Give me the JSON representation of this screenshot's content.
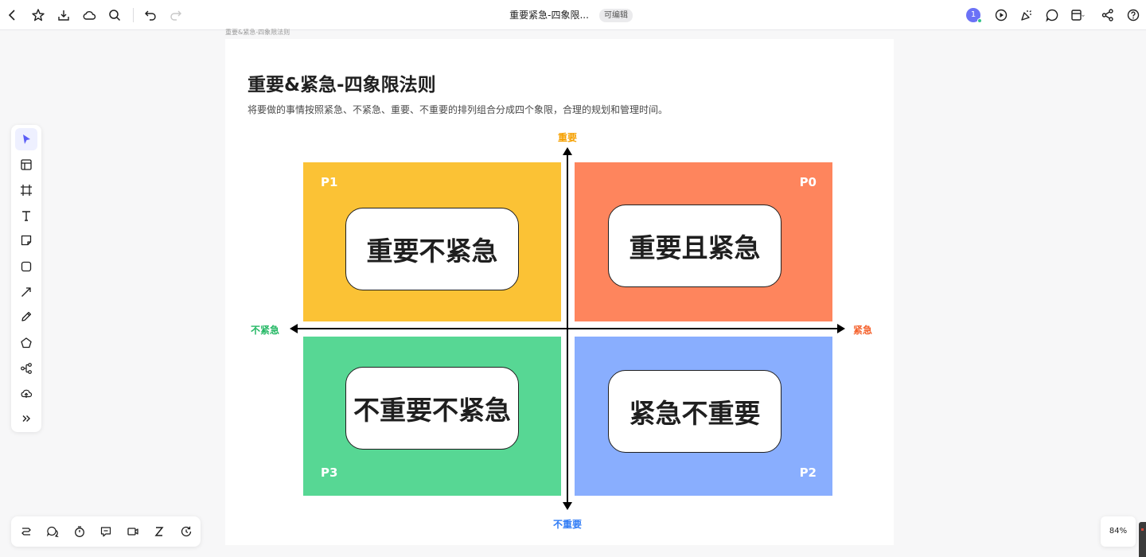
{
  "topbar": {
    "doc_title": "重要紧急-四象限...",
    "edit_badge": "可编辑",
    "collaborator_count": "1",
    "left_icons": [
      "back-icon",
      "star-icon",
      "import-icon",
      "cloud-icon",
      "search-icon",
      "undo-icon",
      "redo-icon"
    ],
    "right_icons": [
      "play-icon",
      "celebrate-icon",
      "comment-icon",
      "layout-icon",
      "share-icon",
      "help-icon"
    ]
  },
  "canvas": {
    "breadcrumb": "重要&紧急-四象限法则",
    "title": "重要&紧急-四象限法则",
    "description": "将要做的事情按照紧急、不紧急、重要、不重要的排列组合分成四个象限，合理的规划和管理时间。",
    "axis": {
      "top": "重要",
      "bottom": "不重要",
      "left": "不紧急",
      "right": "紧急"
    },
    "quadrants": {
      "top_left": {
        "priority": "P1",
        "label": "重要不紧急",
        "color": "#fbc235"
      },
      "top_right": {
        "priority": "P0",
        "label": "重要且紧急",
        "color": "#fe855d"
      },
      "bottom_left": {
        "priority": "P3",
        "label": "不重要不紧急",
        "color": "#57d794"
      },
      "bottom_right": {
        "priority": "P2",
        "label": "紧急不重要",
        "color": "#89aefe"
      }
    },
    "axis_colors": {
      "top": "#f5a000",
      "bottom": "#2f7bf5",
      "left": "#25b865",
      "right": "#f5622d"
    }
  },
  "left_toolbar": [
    "select-icon",
    "template-icon",
    "frame-icon",
    "text-icon",
    "sticky-note-icon",
    "shape-icon",
    "connector-icon",
    "pen-icon",
    "polygon-icon",
    "mindmap-icon",
    "upload-icon",
    "more-icon"
  ],
  "bottom_toolbar": [
    "flow-icon",
    "comments-icon",
    "timer-icon",
    "chat-icon",
    "video-icon",
    "sleep-icon",
    "history-icon"
  ],
  "zoom": "84%"
}
